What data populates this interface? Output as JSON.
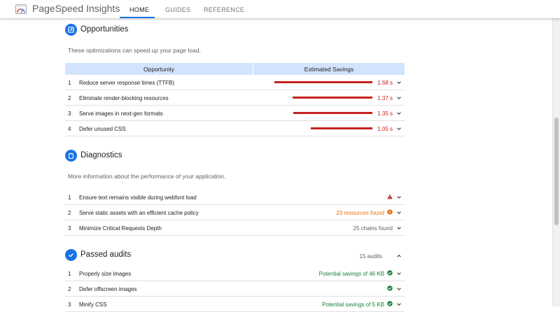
{
  "app": {
    "title": "PageSpeed Insights",
    "tabs": [
      {
        "label": "HOME",
        "active": true
      },
      {
        "label": "GUIDES",
        "active": false
      },
      {
        "label": "REFERENCE",
        "active": false
      }
    ]
  },
  "colors": {
    "accent": "#1a73e8",
    "fail": "#c5221f",
    "average": "#e8710a",
    "pass": "#188038",
    "table_header": "#d3e3fd"
  },
  "opportunities": {
    "title": "Opportunities",
    "icon": "opportunity-icon",
    "description": "These optimizations can speed up your page load.",
    "col_opportunity": "Opportunity",
    "col_savings": "Estimated Savings",
    "rows": [
      {
        "num": "1",
        "label": "Reduce server response times (TTFB)",
        "savings": "1.68 s",
        "seconds": 1.68
      },
      {
        "num": "2",
        "label": "Eliminate render-blocking resources",
        "savings": "1.37 s",
        "seconds": 1.37
      },
      {
        "num": "3",
        "label": "Serve images in next-gen formats",
        "savings": "1.35 s",
        "seconds": 1.35
      },
      {
        "num": "4",
        "label": "Defer unused CSS",
        "savings": "1.05 s",
        "seconds": 1.05
      }
    ]
  },
  "diagnostics": {
    "title": "Diagnostics",
    "icon": "clipboard-icon",
    "description": "More information about the performance of your application.",
    "rows": [
      {
        "num": "1",
        "label": "Ensure text remains visible during webfont load",
        "value": "",
        "status_icon": "warning-triangle-icon"
      },
      {
        "num": "2",
        "label": "Serve static assets with an efficient cache policy",
        "value": "23 resources found",
        "status_icon": "info-circle-icon"
      },
      {
        "num": "3",
        "label": "Minimize Critical Requests Depth",
        "value": "25 chains found",
        "status_icon": ""
      }
    ]
  },
  "passed": {
    "title": "Passed audits",
    "icon": "check-icon",
    "count": "15 audits",
    "rows": [
      {
        "num": "1",
        "label": "Properly size images",
        "value": "Potential savings of 46 KB",
        "status_icon": "check-circle-icon"
      },
      {
        "num": "2",
        "label": "Defer offscreen images",
        "value": "",
        "status_icon": "check-circle-icon"
      },
      {
        "num": "3",
        "label": "Minify CSS",
        "value": "Potential savings of 5 KB",
        "status_icon": "check-circle-icon"
      }
    ]
  }
}
